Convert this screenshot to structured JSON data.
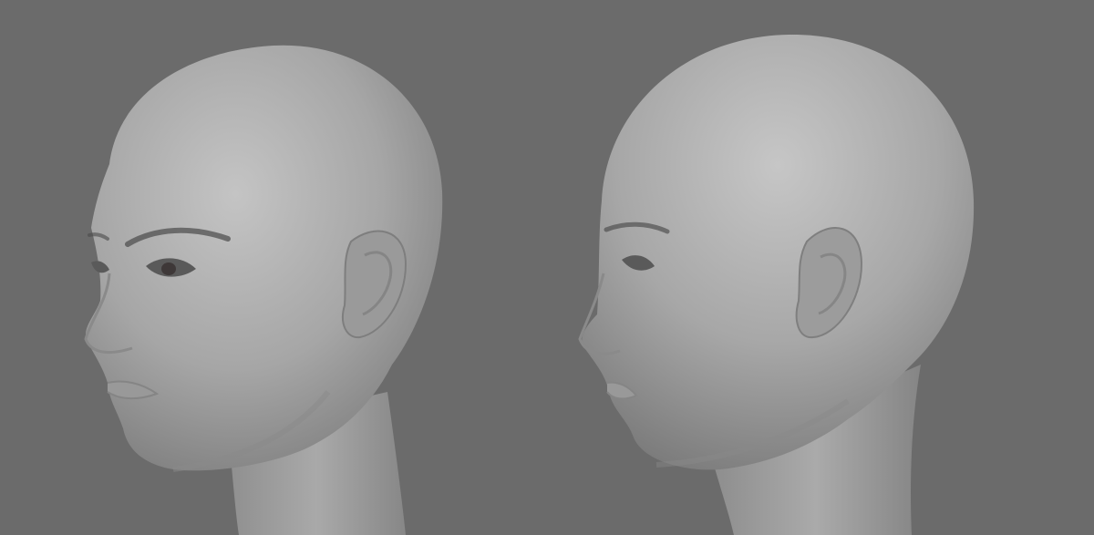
{
  "scene": {
    "background_color": "#6b6b6b",
    "skin_color": "#a8a8a8",
    "renders": [
      {
        "view": "three-quarter"
      },
      {
        "view": "profile"
      }
    ]
  }
}
